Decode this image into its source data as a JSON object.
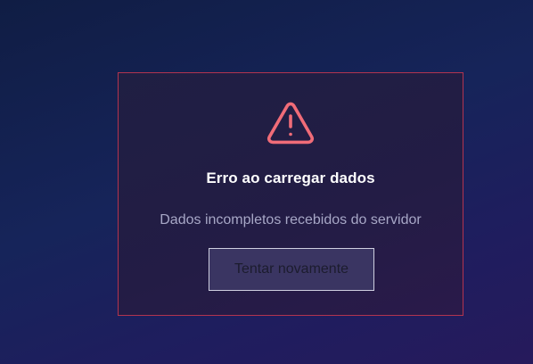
{
  "error": {
    "icon": "warning-triangle-icon",
    "title": "Erro ao carregar dados",
    "message": "Dados incompletos recebidos do servidor",
    "retry_label": "Tentar novamente"
  },
  "colors": {
    "icon": "#f06c78",
    "border": "#b2344f",
    "title": "#ffffff",
    "message": "#a7a7c6"
  }
}
